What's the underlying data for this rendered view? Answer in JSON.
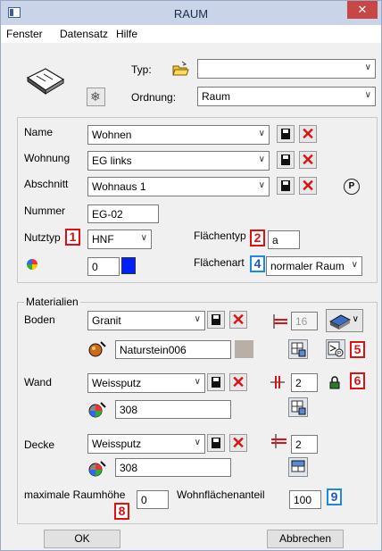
{
  "window": {
    "title": "RAUM",
    "close_glyph": "✕"
  },
  "menu": {
    "items": [
      "Fenster",
      "Datensatz",
      "Hilfe"
    ]
  },
  "top": {
    "typ_label": "Typ:",
    "typ_value": "",
    "ordnung_label": "Ordnung:",
    "ordnung_value": "Raum"
  },
  "main": {
    "name_label": "Name",
    "name_value": "Wohnen",
    "wohnung_label": "Wohnung",
    "wohnung_value": "EG links",
    "abschnitt_label": "Abschnitt",
    "abschnitt_value": "Wohnaus 1",
    "p_glyph": "P",
    "nummer_label": "Nummer",
    "nummer_value": "EG-02",
    "nutztyp_label": "Nutztyp",
    "nutztyp_badge": "1",
    "nutztyp_value": "HNF",
    "flaechentyp_label": "Flächentyp",
    "flaechentyp_badge": "2",
    "flaechentyp_value": "a",
    "color_value": "0",
    "flaechenart_label": "Flächenart",
    "flaechenart_badge": "4",
    "flaechenart_value": "normaler Raum",
    "swatch_color": "#0020ff"
  },
  "materials": {
    "group_label": "Materialien",
    "boden_label": "Boden",
    "boden_value": "Granit",
    "boden_texture": "Naturstein006",
    "boden_thickness": "16",
    "badge5": "5",
    "wand_label": "Wand",
    "wand_value": "Weissputz",
    "wand_color": "308",
    "wand_thickness": "2",
    "badge6": "6",
    "decke_label": "Decke",
    "decke_value": "Weissputz",
    "decke_color": "308",
    "decke_thickness": "2",
    "max_height_label": "maximale Raumhöhe",
    "max_height_value": "0",
    "badge8": "8",
    "wohnflaeche_label": "Wohnflächenanteil",
    "wohnflaeche_value": "100",
    "badge9": "9"
  },
  "footer": {
    "ok_label": "OK",
    "cancel_label": "Abbrechen"
  },
  "colors": {
    "accent_red": "#e01010",
    "accent_blue": "#1a8ae8",
    "close_bg": "#c74747"
  }
}
